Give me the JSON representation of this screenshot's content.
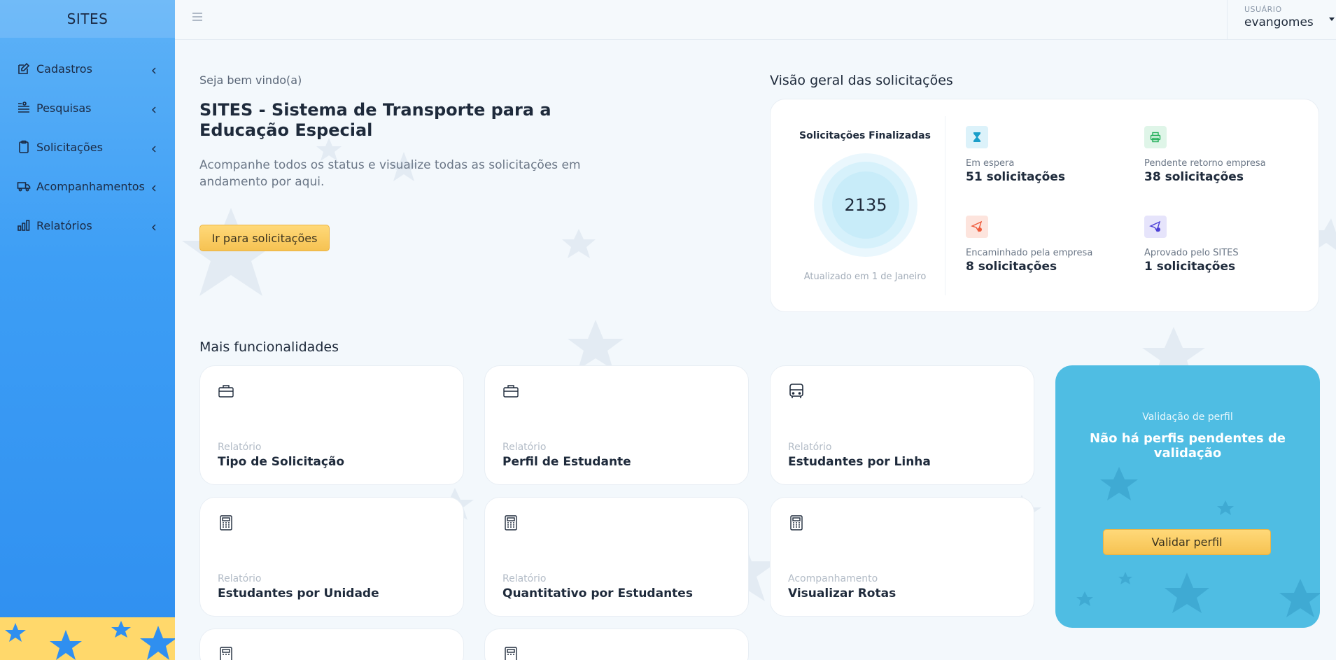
{
  "sidebar": {
    "brand": "SITES",
    "items": [
      {
        "label": "Cadastros",
        "icon": "edit-icon"
      },
      {
        "label": "Pesquisas",
        "icon": "search-list-icon"
      },
      {
        "label": "Solicitações",
        "icon": "clipboard-icon"
      },
      {
        "label": "Acompanhamentos",
        "icon": "truck-icon"
      },
      {
        "label": "Relatórios",
        "icon": "bar-chart-icon"
      }
    ]
  },
  "topbar": {
    "user_label": "USUÁRIO",
    "user_name": "evangomes"
  },
  "welcome": {
    "greeting": "Seja bem vindo(a)",
    "title": "SITES - Sistema de Transporte para a Educação Especial",
    "description": "Acompanhe todos os status e visualize todas as solicitações em andamento por aqui.",
    "button": "Ir para solicitações"
  },
  "overview": {
    "title": "Visão geral das solicitações",
    "finalized_title": "Solicitações Finalizadas",
    "finalized_value": "2135",
    "updated": "Atualizado em 1 de Janeiro",
    "stats": [
      {
        "label": "Em espera",
        "value": "51 solicitações",
        "icon": "hourglass-icon",
        "color": "#1a9ec9",
        "bg": "#dcf2fa"
      },
      {
        "label": "Pendente retorno empresa",
        "value": "38 solicitações",
        "icon": "printer-icon",
        "color": "#23b05a",
        "bg": "#dff5e8"
      },
      {
        "label": "Encaminhado pela empresa",
        "value": "8 solicitações",
        "icon": "send-cancel-icon",
        "color": "#ef5a3b",
        "bg": "#fde4dd"
      },
      {
        "label": "Aprovado pelo SITES",
        "value": "1 solicitações",
        "icon": "send-check-icon",
        "color": "#4b3fd6",
        "bg": "#e6e4fb"
      }
    ]
  },
  "more": {
    "title": "Mais funcionalidades",
    "cards": [
      {
        "category": "Relatório",
        "name": "Tipo de Solicitação",
        "icon": "briefcase-icon"
      },
      {
        "category": "Relatório",
        "name": "Perfil de Estudante",
        "icon": "briefcase-icon"
      },
      {
        "category": "Relatório",
        "name": "Estudantes por Linha",
        "icon": "bus-icon"
      },
      {
        "category": "Relatório",
        "name": "Estudantes por Unidade",
        "icon": "calculator-icon"
      },
      {
        "category": "Relatório",
        "name": "Quantitativo por Estudantes",
        "icon": "calculator-icon"
      },
      {
        "category": "Acompanhamento",
        "name": "Visualizar Rotas",
        "icon": "calculator-icon"
      },
      {
        "category": "",
        "name": "",
        "icon": "calculator-icon"
      },
      {
        "category": "",
        "name": "",
        "icon": "calculator-icon"
      }
    ]
  },
  "validation": {
    "small": "Validação de perfil",
    "title": "Não há perfis pendentes de validação",
    "button": "Validar perfil"
  }
}
